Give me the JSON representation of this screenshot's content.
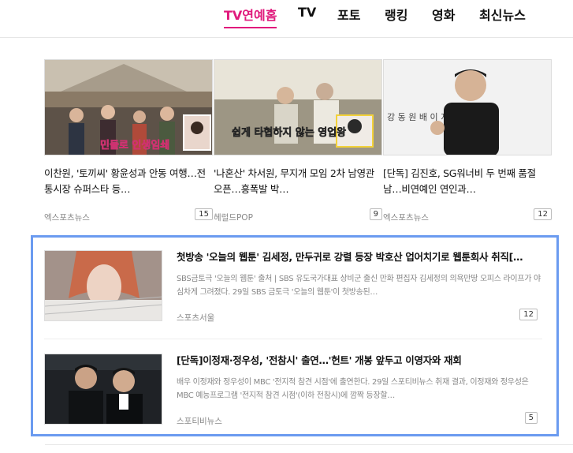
{
  "nav": {
    "items": [
      {
        "label": "TV연예홈",
        "active": true
      },
      {
        "label": "TV",
        "active": false
      },
      {
        "label": "포토",
        "active": false
      },
      {
        "label": "랭킹",
        "active": false
      },
      {
        "label": "영화",
        "active": false
      },
      {
        "label": "최신뉴스",
        "active": false
      }
    ],
    "active_color": "#e01a7c"
  },
  "grid": [
    {
      "title": "이찬원, '토끼씨' 황윤성과 안동 여행…전통시장 슈퍼스타 등…",
      "source": "엑스포츠뉴스",
      "count": "15",
      "thumb_caption": "민들로 인생임쇄"
    },
    {
      "title": "'나혼산' 차서원, 무지개 모임 2차 남영관 오픈…흥폭발 박…",
      "source": "헤럴드POP",
      "count": "9",
      "thumb_caption": "쉽게 타협하지 않는 영업왕"
    },
    {
      "title": "[단독] 김진호, SG워너비 두 번째 품절남…비연예인 연인과…",
      "source": "엑스포츠뉴스",
      "count": "12",
      "thumb_caption": "강 동 원   배   이 지 은"
    }
  ],
  "list": [
    {
      "title": "첫방송 '오늘의 웹툰' 김세정, 만두귀로 강렬 등장 박호산 업어치기로 웹툰회사 취직[…",
      "summary": "SBS금토극 '오늘의 웹툰' 출처 | SBS 유도국가대표 상비군 출신 만화 편집자 김세정의 의욕만땅 오피스 라이프가 야심차게 그려졌다. 29일 SBS 금토극 '오늘의 웹툰'이 첫방송된…",
      "source": "스포츠서울",
      "count": "12"
    },
    {
      "title": "[단독]이정재·정우성, '전참시' 출연…'헌트' 개봉 앞두고 이영자와 재회",
      "summary": "배우 이정재와 정우성이 MBC '전지적 참견 시점'에 출연한다. 29일 스포티비뉴스 취재 결과, 이정재와 정우성은 MBC 예능프로그램 '전지적 참견 시점'(이하 전참시)에 깜짝 등장할…",
      "source": "스포티비뉴스",
      "count": "5"
    }
  ],
  "highlight_color": "#6b9bf0"
}
